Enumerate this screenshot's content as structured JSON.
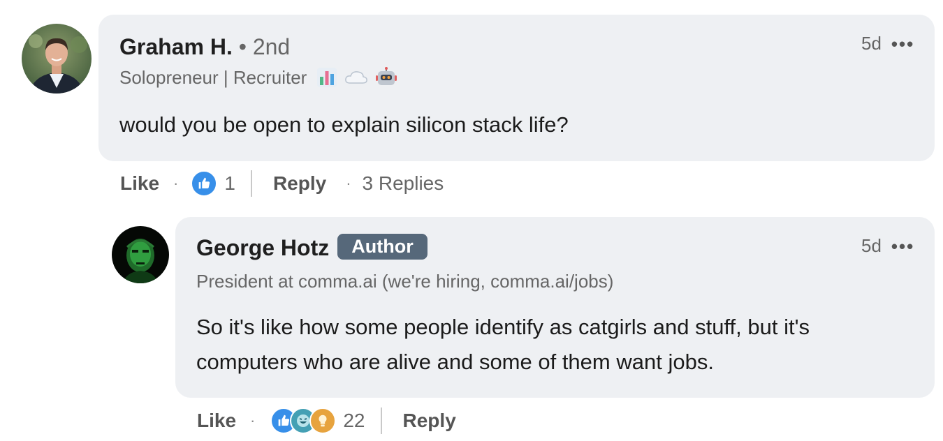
{
  "comment": {
    "author_name": "Graham H.",
    "connection_degree": "• 2nd",
    "headline": "Solopreneur | Recruiter",
    "headline_icons": [
      "bar-chart-icon",
      "cloud-icon",
      "robot-icon"
    ],
    "timestamp": "5d",
    "more_label": "•••",
    "text": "would you be open to explain silicon stack life?",
    "actions": {
      "like_label": "Like",
      "separator": "·",
      "reaction_count": "1",
      "reply_label": "Reply",
      "replies_label": "3 Replies"
    }
  },
  "reply": {
    "author_name": "George Hotz",
    "badge": "Author",
    "headline": "President at comma.ai (we're hiring, comma.ai/jobs)",
    "timestamp": "5d",
    "more_label": "•••",
    "text_line1": "So it's like how some people identify as catgirls and stuff, but it's",
    "text_line2": "computers who are alive and some of them want jobs.",
    "actions": {
      "like_label": "Like",
      "separator": "·",
      "reaction_count": "22",
      "reply_label": "Reply"
    }
  },
  "colors": {
    "bubble_bg": "#eef0f3",
    "like_blue": "#378fe9",
    "celebrate_teal": "#44a0b4",
    "insightful_gold": "#e7a33e",
    "badge_bg": "#56687a"
  }
}
